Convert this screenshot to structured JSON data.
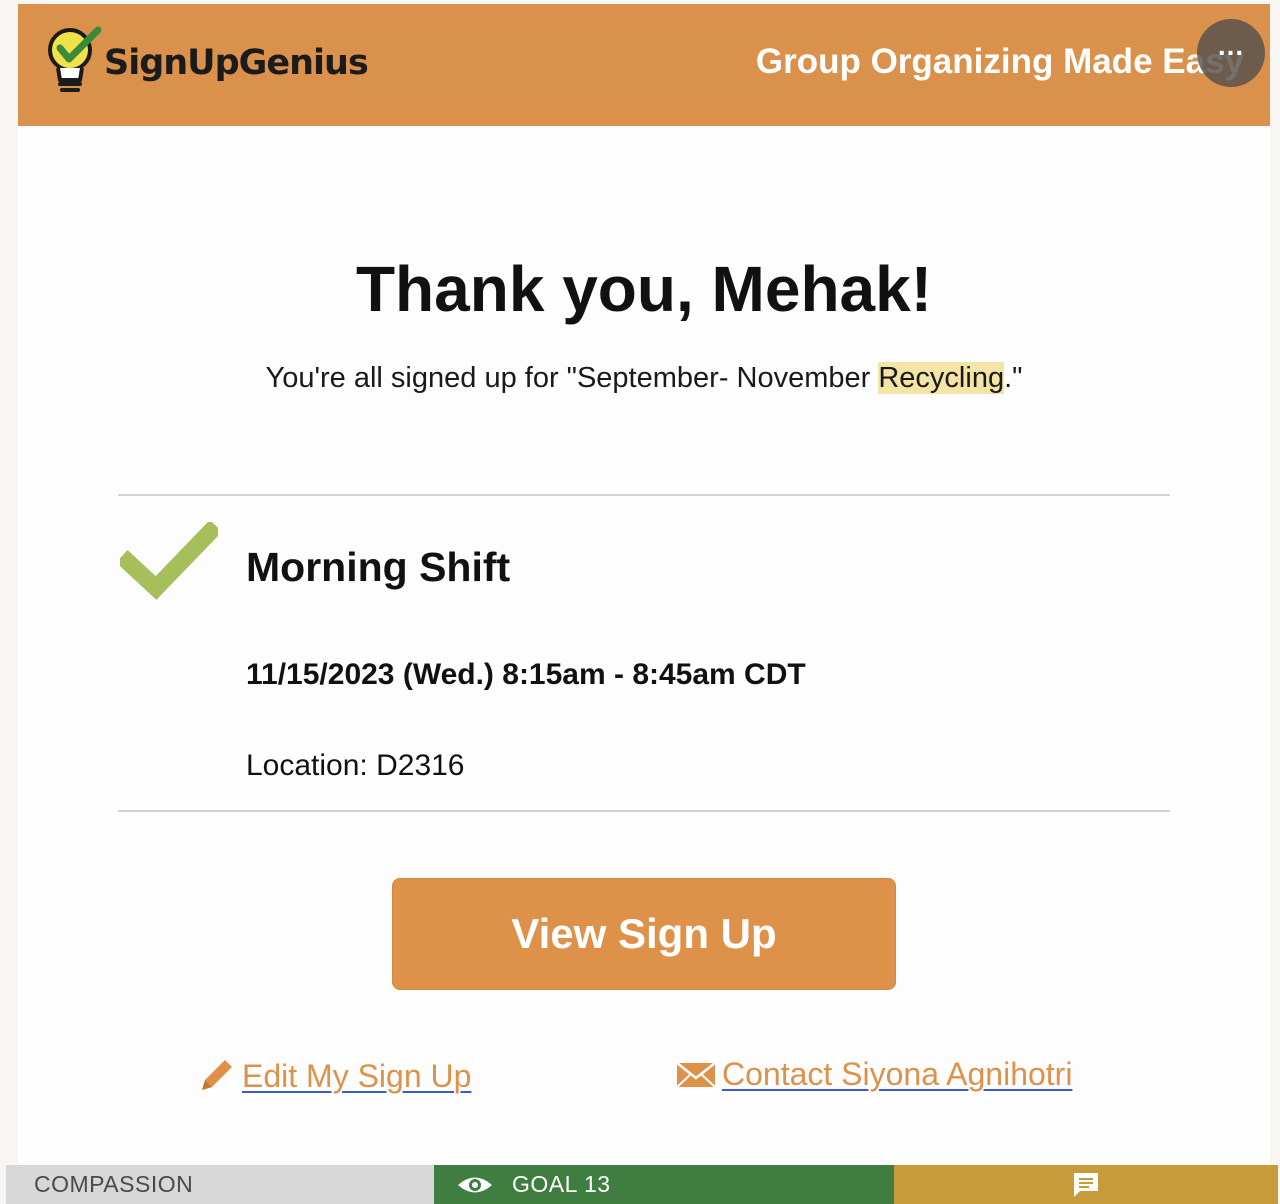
{
  "header": {
    "logo_text": "SignUpGenius",
    "tagline": "Group Organizing Made Easy",
    "more_label": "..."
  },
  "main": {
    "thanks": "Thank you, Mehak!",
    "confirm_prefix": "You're all signed up for \"September- November ",
    "confirm_highlight": "Recycling",
    "confirm_suffix": ".\""
  },
  "slot": {
    "title": "Morning Shift",
    "datetime": "11/15/2023 (Wed.) 8:15am - 8:45am CDT",
    "location": "Location: D2316"
  },
  "actions": {
    "view_label": "View Sign Up",
    "edit_label": "Edit My Sign Up",
    "contact_label": "Contact Siyona Agnihotri"
  },
  "bottom_bar": {
    "left_label": "COMPASSION",
    "goal_label": "GOAL 13"
  },
  "colors": {
    "brand_orange": "#d9914c",
    "button_orange": "#de9249",
    "check_green": "#a6bf5a",
    "link_underline": "#3b5bd6",
    "bar_green": "#3f7d40",
    "bar_gold": "#c79a3a"
  },
  "icons": [
    "lightbulb-check-logo-icon",
    "more-dots-icon",
    "checkmark-icon",
    "pencil-icon",
    "envelope-icon",
    "eye-icon",
    "chat-icon"
  ]
}
